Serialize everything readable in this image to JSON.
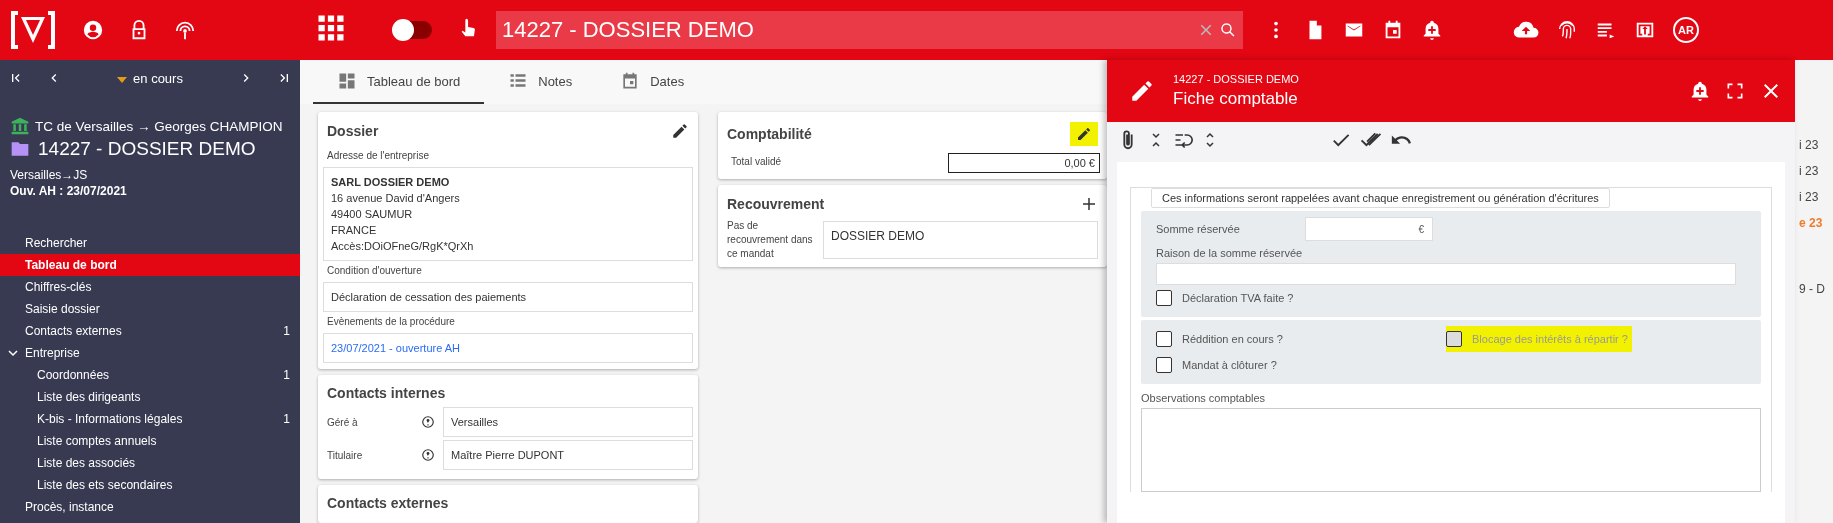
{
  "top_bar": {
    "search_value": "14227 - DOSSIER DEMO",
    "toggle_on": false,
    "avatar": "AR"
  },
  "sidebar": {
    "nav_status": "en cours",
    "court": "TC de Versailles → Georges CHAMPION",
    "dossier": "14227 - DOSSIER DEMO",
    "location": "Versailles→JS",
    "opening": "Ouv. AH : 23/07/2021",
    "items": [
      {
        "label": "Rechercher",
        "selected": false
      },
      {
        "label": "Tableau de bord",
        "selected": true
      },
      {
        "label": "Chiffres-clés",
        "selected": false
      },
      {
        "label": "Saisie dossier",
        "selected": false
      },
      {
        "label": "Contacts externes",
        "selected": false,
        "count": "1"
      },
      {
        "label": "Entreprise",
        "selected": false,
        "expanded": true,
        "children": [
          {
            "label": "Coordonnées",
            "selected": false,
            "count": "1"
          },
          {
            "label": "Liste des dirigeants",
            "selected": false
          },
          {
            "label": "K-bis - Informations légales",
            "selected": false,
            "count": "1"
          },
          {
            "label": "Liste comptes annuels",
            "selected": false
          },
          {
            "label": "Liste des associés",
            "selected": false
          },
          {
            "label": "Liste des ets secondaires",
            "selected": false
          }
        ]
      },
      {
        "label": "Procès, instance",
        "selected": false
      }
    ]
  },
  "tabs": [
    {
      "label": "Tableau de bord",
      "selected": true
    },
    {
      "label": "Notes",
      "selected": false
    },
    {
      "label": "Dates",
      "selected": false
    }
  ],
  "dossier_card": {
    "title": "Dossier",
    "address_label": "Adresse de l'entreprise",
    "company": "SARL DOSSIER DEMO",
    "address_lines": [
      "16 avenue David d'Angers",
      "49400 SAUMUR",
      "FRANCE",
      "Accès:DOiOFneG/RgK*QrXh"
    ],
    "condition_label": "Condition d'ouverture",
    "condition": "Déclaration de cessation des paiements",
    "events_label": "Evènements de la procédure",
    "event": "23/07/2021 - ouverture AH"
  },
  "contacts_internes": {
    "title": "Contacts internes",
    "rows": [
      {
        "label": "Géré à",
        "value": "Versailles"
      },
      {
        "label": "Titulaire",
        "value": "Maître Pierre DUPONT"
      }
    ]
  },
  "contacts_externes": {
    "title": "Contacts externes"
  },
  "comptabilite": {
    "title": "Comptabilité",
    "edit_highlighted": true,
    "total_label": "Total validé",
    "total_value": "0,00 €"
  },
  "recouvrement": {
    "title": "Recouvrement",
    "label": "Pas de recouvrement dans ce mandat",
    "value": "DOSSIER DEMO"
  },
  "panel": {
    "subtitle": "14227 - DOSSIER DEMO",
    "title": "Fiche comptable",
    "legend": "Ces informations seront rappelées avant chaque enregistrement ou génération d'écritures",
    "amount_label": "Somme réservée",
    "amount_suffix": "€",
    "reason_label": "Raison de la somme réservée",
    "vat": {
      "label": "Déclaration TVA faite ?",
      "checked": false,
      "disabled": false,
      "highlighted": false
    },
    "checks": [
      {
        "label": "Réddition en cours ?",
        "checked": false,
        "disabled": false,
        "highlighted": false
      },
      {
        "label": "Blocage des intérêts à répartir ?",
        "checked": false,
        "disabled": true,
        "highlighted": true
      },
      {
        "label": "Mandat à clôturer ?",
        "checked": false,
        "disabled": false,
        "highlighted": false
      }
    ],
    "observations_label": "Observations comptables"
  },
  "background_list": [
    {
      "text": "i 23",
      "kind": "normal"
    },
    {
      "text": "i 23",
      "kind": "normal"
    },
    {
      "text": "i 23",
      "kind": "normal"
    },
    {
      "text": "e 23",
      "kind": "warning"
    },
    {
      "text": "9 - D",
      "kind": "normal"
    }
  ]
}
